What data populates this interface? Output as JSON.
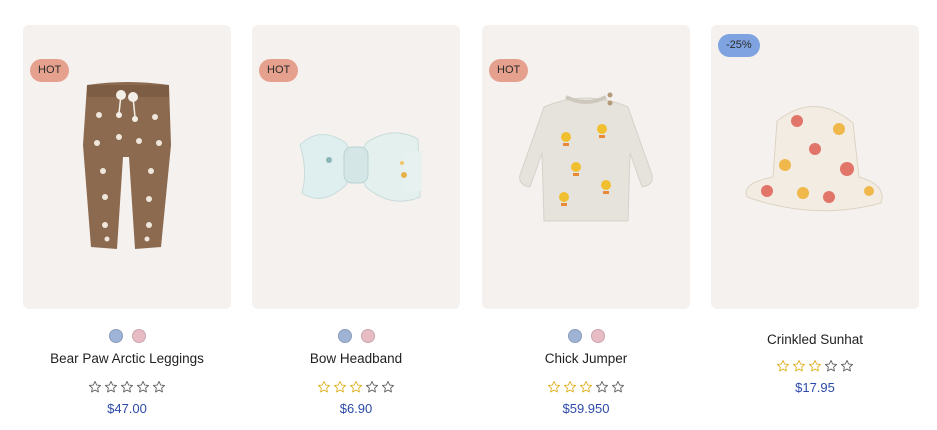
{
  "colors": {
    "card_bg": "#f5f1ef",
    "hot_badge": "#e6a08e",
    "sale_badge": "#7ea3e0",
    "price": "#2c4aa8",
    "star_filled": "#e0b42a",
    "star_empty": "#666666"
  },
  "products": [
    {
      "name": "Bear Paw Arctic Leggings",
      "badge": "HOT",
      "price": "$47.00",
      "rating": 0,
      "swatches": [
        "#9fb3d6",
        "#e8bcc4"
      ],
      "icon": "leggings-image"
    },
    {
      "name": "Bow Headband",
      "badge": "HOT",
      "price": "$6.90",
      "rating": 3,
      "swatches": [
        "#9fb3d6",
        "#e8bcc4"
      ],
      "icon": "headband-image"
    },
    {
      "name": "Chick Jumper",
      "badge": "HOT",
      "price": "$59.950",
      "rating": 3,
      "swatches": [
        "#9fb3d6",
        "#e8bcc4"
      ],
      "icon": "jumper-image"
    },
    {
      "name": "Crinkled Sunhat",
      "badge": "-25%",
      "price": "$17.95",
      "rating": 3,
      "swatches": [],
      "icon": "sunhat-image"
    }
  ]
}
